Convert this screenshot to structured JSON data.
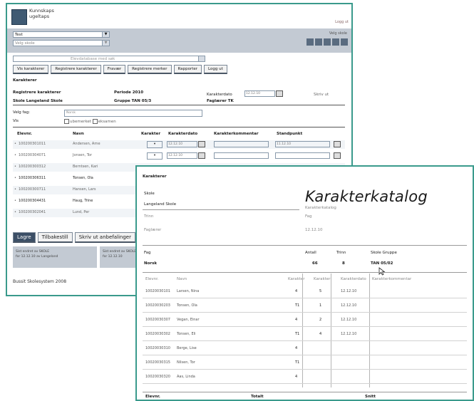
{
  "back_window": {
    "logo_line1": "Kunnskaps",
    "logo_line2": "ugeltaps",
    "header_right": "Logg ut",
    "select_a": "Test",
    "select_b": "Velg skole",
    "band_text": "Velg skole ",
    "search_placeholder": "Elevdatabase med søk",
    "buttons": [
      "Vis karakterer",
      "Registrere karakterer",
      "Fravær",
      "Registrere merker",
      "Rapporter",
      "Logg ut"
    ],
    "section": "Karakterer",
    "reg_label": "Registrere karakterer",
    "periode_label": "Periode 2010",
    "karakterdato_label": "Karakterdato",
    "karakterdato_value": "12.12.10",
    "skole_label": "Skole Langeland Skole",
    "gruppe_label": "Gruppe TAN 05/3",
    "faglaerer_label": "Faglærer TK",
    "velg_fag_label": "Velg fag:",
    "velg_fag_value": "Norsk",
    "vis_label": "Vis",
    "vis_option1": "ubemerket",
    "vis_option2": "eksamen",
    "table_headers": [
      "Elevnr.",
      "Navn",
      "Karakter",
      "Karakterdato",
      "Karakterkommentar",
      "Standpunkt"
    ],
    "rows": [
      {
        "nr": "100200301011",
        "name": "Andersen, Arne",
        "kar": "",
        "dato": "12.12.10",
        "std": "11.12.10"
      },
      {
        "nr": "100200304071",
        "name": "Jonsen, Tor",
        "kar": "",
        "dato": "12.12.10",
        "std": ""
      },
      {
        "nr": "100200300312",
        "name": "Berntsen, Kari",
        "kar": "",
        "dato": "",
        "std": ""
      },
      {
        "nr": "100200306311",
        "name": "Tonsen, Ola",
        "kar": "",
        "dato": "",
        "std": ""
      },
      {
        "nr": "100200300711",
        "name": "Hansen, Lars",
        "kar": "",
        "dato": "",
        "std": ""
      },
      {
        "nr": "100200304431",
        "name": "Haug, Trine",
        "kar": "",
        "dato": "",
        "std": ""
      },
      {
        "nr": "100200302041",
        "name": "Lund, Per",
        "kar": "",
        "dato": "",
        "std": ""
      }
    ],
    "bottom_buttons": [
      "Lagre",
      "Tilbakestill",
      "Skriv ut anbefalinger"
    ],
    "foot_box1": "Sist endret av SKOLE\nfor 12.12.10 av Langeland",
    "foot_box2": "Sist endret av SKOLE\nfor 12.12.10",
    "copyright": "Bussit Skolesystem 2008"
  },
  "front_window": {
    "section": "Karakterer",
    "title": "Karakterkatalog",
    "fields_left": [
      "Skole",
      "Langeland Skole",
      "Trinn",
      "Faglærer"
    ],
    "fields_right": [
      "Karakterkatalog",
      "Fag",
      "12.12.10"
    ],
    "summary_headers": [
      "Fag",
      "Antall",
      "Trinn",
      "Skole Gruppe"
    ],
    "summary_values": [
      "Norsk",
      "66",
      "8",
      "TAN 05/02"
    ],
    "table_headers": [
      "Elevnr.",
      "Navn",
      "Karakter",
      "Karakter",
      "Karakterdato",
      "Karakterkommentar"
    ],
    "rows": [
      {
        "nr": "10020030101",
        "name": "Larsen, Nina",
        "k1": "4",
        "k2": "5",
        "dato": "12.12.10"
      },
      {
        "nr": "10020030203",
        "name": "Tonsen, Ola",
        "k1": "T1",
        "k2": "1",
        "dato": "12.12.10"
      },
      {
        "nr": "10020030307",
        "name": "Vegan, Einar",
        "k1": "4",
        "k2": "2",
        "dato": "12.12.10"
      },
      {
        "nr": "10020030302",
        "name": "Tonsen, Eli",
        "k1": "T1",
        "k2": "4",
        "dato": "12.12.10"
      },
      {
        "nr": "10020030310",
        "name": "Berge, Lise",
        "k1": "4",
        "k2": "",
        "dato": ""
      },
      {
        "nr": "10020030315",
        "name": "Nilsen, Tor",
        "k1": "T1",
        "k2": "",
        "dato": ""
      },
      {
        "nr": "10020030320",
        "name": "Aas, Linda",
        "k1": "4",
        "k2": "",
        "dato": ""
      }
    ],
    "footer": [
      "Elevnr.",
      "Totalt",
      "Snitt"
    ]
  }
}
